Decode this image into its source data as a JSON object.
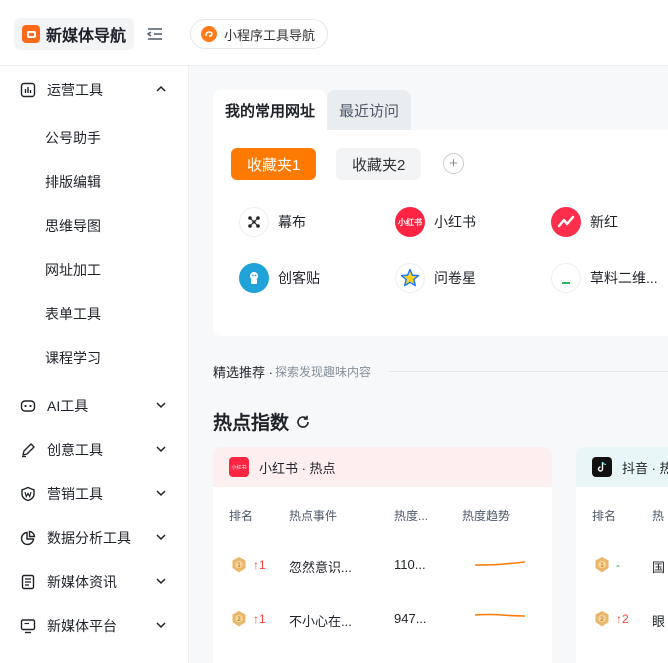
{
  "header": {
    "brand": "新媒体导航",
    "miniprogram_label": "小程序工具导航"
  },
  "sidebar": {
    "groups": [
      {
        "label": "运营工具",
        "icon": "bar-chart-icon",
        "expanded": true,
        "items": [
          "公号助手",
          "排版编辑",
          "思维导图",
          "网址加工",
          "表单工具",
          "课程学习"
        ]
      },
      {
        "label": "AI工具",
        "icon": "robot-icon",
        "expanded": false
      },
      {
        "label": "创意工具",
        "icon": "pen-icon",
        "expanded": false
      },
      {
        "label": "营销工具",
        "icon": "shield-icon",
        "expanded": false
      },
      {
        "label": "数据分析工具",
        "icon": "pie-chart-icon",
        "expanded": false
      },
      {
        "label": "新媒体资讯",
        "icon": "news-icon",
        "expanded": false
      },
      {
        "label": "新媒体平台",
        "icon": "monitor-icon",
        "expanded": false
      }
    ]
  },
  "favorites": {
    "tabs": [
      "我的常用网址",
      "最近访问"
    ],
    "folders": [
      "收藏夹1",
      "收藏夹2"
    ],
    "add_symbol": "+",
    "sites": [
      {
        "name": "幕布",
        "icon": "mubu-icon"
      },
      {
        "name": "小红书",
        "icon": "xiaohongshu-icon",
        "icon_text": "小红书"
      },
      {
        "name": "新红",
        "icon": "xinhong-icon"
      },
      {
        "name": "创客贴",
        "icon": "chuangketie-icon"
      },
      {
        "name": "问卷星",
        "icon": "wenjuanxing-icon"
      },
      {
        "name": "草料二维...",
        "icon": "caoliao-icon"
      }
    ]
  },
  "recommend": {
    "title": "精选推荐 ·",
    "subtitle": "探索发现趣味内容"
  },
  "hot": {
    "title": "热点指数",
    "cards": [
      {
        "source": "小红书 · 热点",
        "logo_text": "小红书",
        "columns": [
          "排名",
          "热点事件",
          "热度...",
          "热度趋势"
        ],
        "rows": [
          {
            "change": "↑1",
            "event": "忽然意识...",
            "heat": "110..."
          },
          {
            "change": "↑1",
            "event": "不小心在...",
            "heat": "947..."
          }
        ]
      },
      {
        "source": "抖音 · 热",
        "columns": [
          "排名",
          "热"
        ],
        "rows": [
          {
            "change": "-",
            "event": "国"
          },
          {
            "change": "↑2",
            "event": "眼"
          }
        ]
      }
    ]
  },
  "colors": {
    "accent": "#ff7a00",
    "rank_up": "#f53f3f",
    "rank_same": "#00b42a",
    "xiaohongshu_red": "#ff2442",
    "douyin_black": "#111111"
  }
}
